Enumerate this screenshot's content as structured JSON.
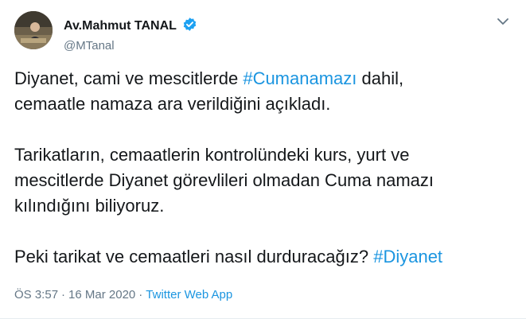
{
  "tweet": {
    "author": {
      "display_name": "Av.Mahmut TANAL",
      "handle": "@MTanal",
      "verified": true
    },
    "paragraphs": [
      {
        "lines": [
          {
            "before": "Diyanet, cami ve mescitlerde ",
            "hashtag": "#Cumanamazı",
            "after": " dahil,"
          },
          {
            "before": "cemaatle namaza ara verildiğini açıkladı.",
            "hashtag": "",
            "after": ""
          }
        ]
      },
      {
        "lines": [
          {
            "before": "Tarikatların, cemaatlerin kontrolündeki kurs, yurt ve",
            "hashtag": "",
            "after": ""
          },
          {
            "before": "mescitlerde Diyanet görevlileri olmadan Cuma namazı",
            "hashtag": "",
            "after": ""
          },
          {
            "before": "kılındığını biliyoruz.",
            "hashtag": "",
            "after": ""
          }
        ]
      },
      {
        "lines": [
          {
            "before": "Peki tarikat ve cemaatleri nasıl durduracağız? ",
            "hashtag": "#Diyanet",
            "after": ""
          }
        ]
      }
    ],
    "time": "ÖS 3:57",
    "separator": "·",
    "date": "16 Mar 2020",
    "source": "Twitter Web App"
  },
  "icons": {
    "verified": "verified-badge-icon",
    "more": "chevron-down-icon",
    "avatar": "profile-photo"
  },
  "colors": {
    "link": "#1b95e0",
    "text": "#14171a",
    "secondary": "#657786"
  }
}
